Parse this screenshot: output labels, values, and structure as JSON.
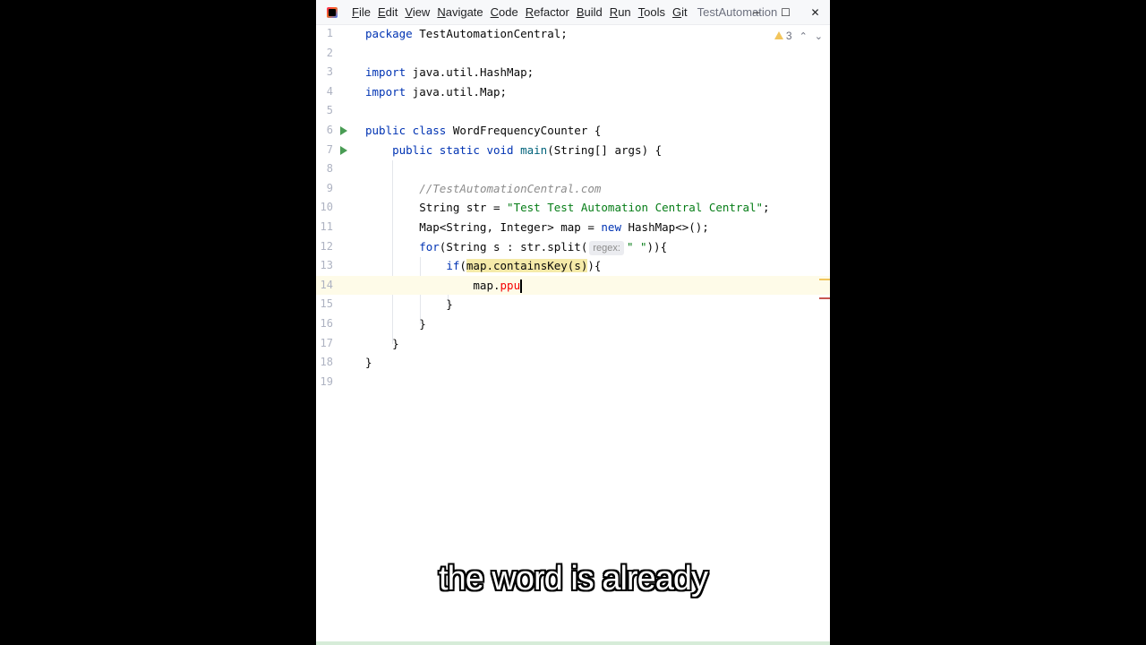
{
  "titlebar": {
    "menu": [
      {
        "mn": "F",
        "rest": "ile"
      },
      {
        "mn": "E",
        "rest": "dit"
      },
      {
        "mn": "V",
        "rest": "iew"
      },
      {
        "mn": "N",
        "rest": "avigate"
      },
      {
        "mn": "C",
        "rest": "ode"
      },
      {
        "mn": "R",
        "rest": "efactor"
      },
      {
        "mn": "B",
        "rest": "uild"
      },
      {
        "mn": "R",
        "rest": "un"
      },
      {
        "mn": "T",
        "rest": "ools"
      },
      {
        "mn": "G",
        "rest": "it"
      }
    ],
    "project_title": "TestAutomation",
    "controls": {
      "minimize": "−",
      "maximize": "☐",
      "close": "✕"
    }
  },
  "inspection": {
    "warnings": "3",
    "up": "⌃",
    "down": "⌄"
  },
  "editor": {
    "current_line": 14,
    "hint": "regex:",
    "lines": [
      {
        "n": "1",
        "parts": [
          {
            "c": "kw",
            "t": "package"
          },
          {
            "c": "",
            "t": " TestAutomationCentral;"
          }
        ]
      },
      {
        "n": "2",
        "parts": []
      },
      {
        "n": "3",
        "parts": [
          {
            "c": "kw",
            "t": "import"
          },
          {
            "c": "",
            "t": " java.util.HashMap;"
          }
        ]
      },
      {
        "n": "4",
        "parts": [
          {
            "c": "kw",
            "t": "import"
          },
          {
            "c": "",
            "t": " java.util.Map;"
          }
        ]
      },
      {
        "n": "5",
        "parts": []
      },
      {
        "n": "6",
        "run": true,
        "parts": [
          {
            "c": "kw",
            "t": "public class"
          },
          {
            "c": "",
            "t": " WordFrequencyCounter {"
          }
        ]
      },
      {
        "n": "7",
        "run": true,
        "parts": [
          {
            "c": "",
            "t": "    "
          },
          {
            "c": "kw",
            "t": "public static void"
          },
          {
            "c": "",
            "t": " "
          },
          {
            "c": "fn",
            "t": "main"
          },
          {
            "c": "",
            "t": "(String[] args) {"
          }
        ]
      },
      {
        "n": "8",
        "parts": []
      },
      {
        "n": "9",
        "parts": [
          {
            "c": "",
            "t": "        "
          },
          {
            "c": "cm",
            "t": "//TestAutomationCentral.com"
          }
        ]
      },
      {
        "n": "10",
        "parts": [
          {
            "c": "",
            "t": "        String str = "
          },
          {
            "c": "str",
            "t": "\"Test Test Automation Central Central\""
          },
          {
            "c": "",
            "t": ";"
          }
        ]
      },
      {
        "n": "11",
        "parts": [
          {
            "c": "",
            "t": "        Map<String, Integer> map = "
          },
          {
            "c": "kw",
            "t": "new"
          },
          {
            "c": "",
            "t": " HashMap<>();"
          }
        ]
      },
      {
        "n": "12",
        "parts": [
          {
            "c": "",
            "t": "        "
          },
          {
            "c": "kw",
            "t": "for"
          },
          {
            "c": "",
            "t": "(String s : str.split("
          },
          {
            "c": "hint",
            "t": "regex:"
          },
          {
            "c": "str",
            "t": "\" \""
          },
          {
            "c": "",
            "t": ")){"
          }
        ]
      },
      {
        "n": "13",
        "parts": [
          {
            "c": "",
            "t": "            "
          },
          {
            "c": "kw",
            "t": "if"
          },
          {
            "c": "",
            "t": "("
          },
          {
            "c": "hl",
            "t": "map.containsKey(s)"
          },
          {
            "c": "",
            "t": "){"
          }
        ]
      },
      {
        "n": "14",
        "parts": [
          {
            "c": "",
            "t": "                map."
          },
          {
            "c": "err",
            "t": "ppu"
          },
          {
            "c": "caret",
            "t": ""
          }
        ]
      },
      {
        "n": "15",
        "parts": [
          {
            "c": "",
            "t": "            }"
          }
        ]
      },
      {
        "n": "16",
        "parts": [
          {
            "c": "",
            "t": "        }"
          }
        ]
      },
      {
        "n": "17",
        "parts": [
          {
            "c": "",
            "t": "    }"
          }
        ]
      },
      {
        "n": "18",
        "parts": [
          {
            "c": "",
            "t": "}"
          }
        ]
      },
      {
        "n": "19",
        "parts": []
      }
    ]
  },
  "subtitle": "the word is already",
  "colors": {
    "keyword": "#0033b3",
    "string": "#067d17",
    "comment": "#8c8c8c",
    "method": "#00627a",
    "error": "#f50000",
    "run_icon": "#499c54",
    "warning": "#f2c55c"
  }
}
